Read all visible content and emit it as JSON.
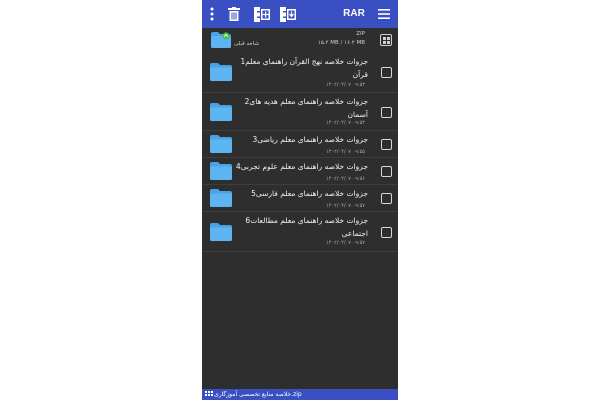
{
  "toolbar": {
    "title": "RAR",
    "icons": [
      "more-vertical-icon",
      "trash-icon",
      "archive-add-icon",
      "archive-extract-icon",
      "hamburger-menu-icon"
    ]
  },
  "parent": {
    "type": "ZIP",
    "size": "۱۵.۲ MB / ۱۶.۲ MB",
    "label": "شاخه قبلی"
  },
  "files": [
    {
      "name": "جزوات خلاصه نهج القرآن راهنمای معلم1 قرآن",
      "date": "۱۴۰۲/۰۴/۰۷ ۰۹:۵۳"
    },
    {
      "name": "جزوات خلاصه راهنمای معلم هدیه های2 آسمان",
      "date": "۱۴۰۲/۰۴/۰۷ ۰۹:۵۴"
    },
    {
      "name": "جزوات خلاصه راهنمای معلم ریاضی3",
      "date": "۱۴۰۲/۰۴/۰۷ ۰۹:۵۵"
    },
    {
      "name": "جزوات خلاصه راهنمای معلم علوم تجربی4",
      "date": "۱۴۰۲/۰۴/۰۷ ۰۹:۵۶"
    },
    {
      "name": "جزوات خلاصه راهنمای معلم فارسی5",
      "date": "۱۴۰۲/۰۴/۰۷ ۰۹:۵۷"
    },
    {
      "name": "جزوات خلاصه راهنمای معلم مطالعات6 اجتماعی",
      "date": "۱۴۰۲/۰۴/۰۷ ۰۹:۵۷"
    }
  ],
  "bottom": {
    "path": "خلاصه منابع تخصصی آموزگاری.zip"
  },
  "colors": {
    "accent": "#3a50c2",
    "background": "#2e2e2e",
    "folder": "#4aa3e8",
    "folder_tab": "#6cc0f5",
    "up_arrow": "#43c04a"
  }
}
